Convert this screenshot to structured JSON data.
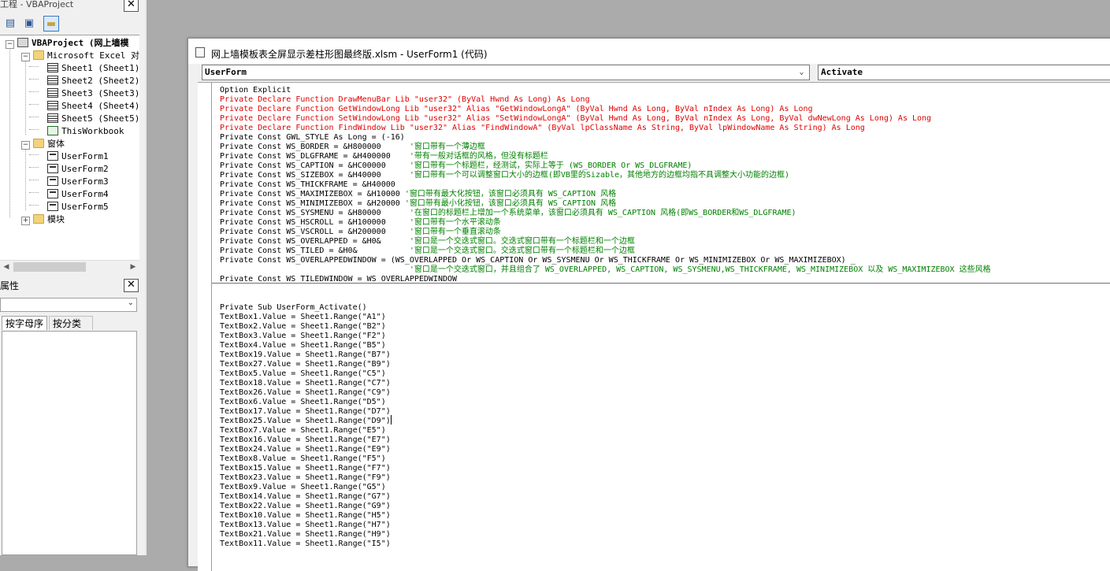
{
  "project_pane": {
    "title": "工程 - VBAProject",
    "close": "✕",
    "tree": {
      "root": "VBAProject (网上墙模",
      "excel_objects_folder": "Microsoft Excel 对象",
      "sheets": [
        "Sheet1 (Sheet1)",
        "Sheet2 (Sheet2)",
        "Sheet3 (Sheet3)",
        "Sheet4 (Sheet4)",
        "Sheet5 (Sheet5)"
      ],
      "workbook": "ThisWorkbook",
      "forms_folder": "窗体",
      "forms": [
        "UserForm1",
        "UserForm2",
        "UserForm3",
        "UserForm4",
        "UserForm5"
      ],
      "modules_folder": "模块"
    }
  },
  "properties_pane": {
    "title": "属性",
    "close": "✕",
    "tabs": [
      "按字母序",
      "按分类序"
    ]
  },
  "code_window": {
    "title": "网上墙模板表全屏显示差柱形图最终版.xlsm - UserForm1 (代码)",
    "object_combo": "UserForm",
    "procedure_combo": "Activate",
    "declarations": [
      {
        "code": "Option Explicit",
        "comment": ""
      },
      {
        "code": "Private Declare Function DrawMenuBar Lib \"user32\" (ByVal Hwnd As Long) As Long",
        "comment": ""
      },
      {
        "code": "Private Declare Function GetWindowLong Lib \"user32\" Alias \"GetWindowLongA\" (ByVal Hwnd As Long, ByVal nIndex As Long) As Long",
        "comment": ""
      },
      {
        "code": "Private Declare Function SetWindowLong Lib \"user32\" Alias \"SetWindowLongA\" (ByVal Hwnd As Long, ByVal nIndex As Long, ByVal dwNewLong As Long) As Long",
        "comment": ""
      },
      {
        "code": "Private Declare Function FindWindow Lib \"user32\" Alias \"FindWindowA\" (ByVal lpClassName As String, ByVal lpWindowName As String) As Long",
        "comment": ""
      },
      {
        "code": "Private Const GWL_STYLE As Long = (-16)",
        "comment": ""
      },
      {
        "code": "Private Const WS_BORDER = &H800000      ",
        "comment": "'窗口带有一个薄边框"
      },
      {
        "code": "Private Const WS_DLGFRAME = &H400000    ",
        "comment": "'带有一般对话框的风格，但没有标题栏"
      },
      {
        "code": "Private Const WS_CAPTION = &HC00000     ",
        "comment": "'窗口带有一个标题栏，经测试，实际上等于 (WS_BORDER Or WS_DLGFRAME)"
      },
      {
        "code": "Private Const WS_SIZEBOX = &H40000      ",
        "comment": "'窗口带有一个可以调整窗口大小的边框(即VB里的Sizable，其他地方的边框均指不具调整大小功能的边框)"
      },
      {
        "code": "Private Const WS_THICKFRAME = &H40000",
        "comment": ""
      },
      {
        "code": "Private Const WS_MAXIMIZEBOX = &H10000 ",
        "comment": "'窗口带有最大化按钮，该窗口必须具有 WS_CAPTION 风格"
      },
      {
        "code": "Private Const WS_MINIMIZEBOX = &H20000 ",
        "comment": "'窗口带有最小化按钮，该窗口必须具有 WS_CAPTION 风格"
      },
      {
        "code": "Private Const WS_SYSMENU = &H80000      ",
        "comment": "'在窗口的标题栏上增加一个系统菜单，该窗口必须具有 WS_CAPTION 风格(即WS_BORDER和WS_DLGFRAME)"
      },
      {
        "code": "Private Const WS_HSCROLL = &H100000     ",
        "comment": "'窗口带有一个水平滚动条"
      },
      {
        "code": "Private Const WS_VSCROLL = &H200000     ",
        "comment": "'窗口带有一个垂直滚动条"
      },
      {
        "code": "Private Const WS_OVERLAPPED = &H0&      ",
        "comment": "'窗口是一个交迭式窗口。交迭式窗口带有一个标题栏和一个边框"
      },
      {
        "code": "Private Const WS_TILED = &H0&           ",
        "comment": "'窗口是一个交迭式窗口。交迭式窗口带有一个标题栏和一个边框"
      },
      {
        "code": "Private Const WS_OVERLAPPEDWINDOW = (WS_OVERLAPPED Or WS_CAPTION Or WS_SYSMENU Or WS_THICKFRAME Or WS_MINIMIZEBOX Or WS_MAXIMIZEBOX) _",
        "comment": ""
      },
      {
        "code": "                                        ",
        "comment": "'窗口是一个交迭式窗口，并且组合了 WS_OVERLAPPED, WS_CAPTION, WS_SYSMENU,WS_THICKFRAME, WS_MINIMIZEBOX 以及 WS_MAXIMIZEBOX 这些风格"
      },
      {
        "code": "Private Const WS_TILEDWINDOW = WS_OVERLAPPEDWINDOW",
        "comment": ""
      }
    ],
    "procedure": [
      "Private Sub UserForm_Activate()",
      "TextBox1.Value = Sheet1.Range(\"A1\")",
      "TextBox2.Value = Sheet1.Range(\"B2\")",
      "TextBox3.Value = Sheet1.Range(\"F2\")",
      "TextBox4.Value = Sheet1.Range(\"B5\")",
      "TextBox19.Value = Sheet1.Range(\"B7\")",
      "TextBox27.Value = Sheet1.Range(\"B9\")",
      "TextBox5.Value = Sheet1.Range(\"C5\")",
      "TextBox18.Value = Sheet1.Range(\"C7\")",
      "TextBox26.Value = Sheet1.Range(\"C9\")",
      "TextBox6.Value = Sheet1.Range(\"D5\")",
      "TextBox17.Value = Sheet1.Range(\"D7\")",
      "TextBox25.Value = Sheet1.Range(\"D9\")",
      "TextBox7.Value = Sheet1.Range(\"E5\")",
      "TextBox16.Value = Sheet1.Range(\"E7\")",
      "TextBox24.Value = Sheet1.Range(\"E9\")",
      "TextBox8.Value = Sheet1.Range(\"F5\")",
      "TextBox15.Value = Sheet1.Range(\"F7\")",
      "TextBox23.Value = Sheet1.Range(\"F9\")",
      "TextBox9.Value = Sheet1.Range(\"G5\")",
      "TextBox14.Value = Sheet1.Range(\"G7\")",
      "TextBox22.Value = Sheet1.Range(\"G9\")",
      "TextBox10.Value = Sheet1.Range(\"H5\")",
      "TextBox13.Value = Sheet1.Range(\"H7\")",
      "TextBox21.Value = Sheet1.Range(\"H9\")",
      "TextBox11.Value = Sheet1.Range(\"I5\")"
    ]
  },
  "colors": {
    "keyword_red": "#e00000",
    "comment_green": "#008000",
    "mdi_background": "#ababab"
  }
}
